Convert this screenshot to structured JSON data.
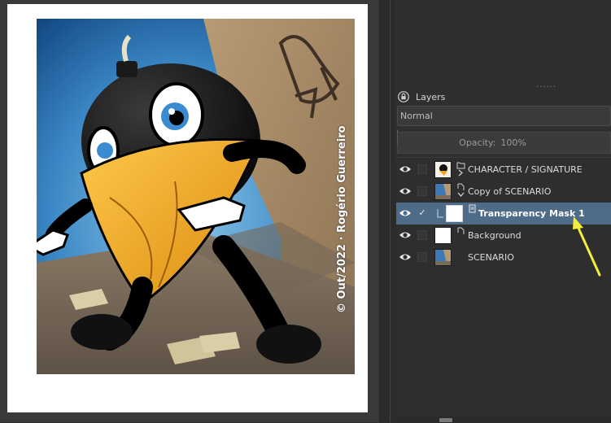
{
  "canvas": {
    "watermark": "© Out/2022 · Rogério Guerreiro",
    "paper_color": "#ffffff",
    "background_color": "#3a3a3a"
  },
  "panel": {
    "title": "Layers",
    "grip": "......",
    "blend_mode": "Normal",
    "opacity_label": "Opacity:",
    "opacity_value": "100%"
  },
  "layers": [
    {
      "name": "CHARACTER  /  SIGNATURE",
      "type": "group-layer",
      "visible": true,
      "selected": false,
      "expanded": false
    },
    {
      "name": "Copy of SCENARIO",
      "type": "clone-layer",
      "visible": true,
      "selected": false,
      "expanded": true
    },
    {
      "name": "Transparency Mask 1",
      "type": "transparency-mask",
      "visible": true,
      "selected": true,
      "checked": true
    },
    {
      "name": "Background",
      "type": "paint-layer",
      "visible": true,
      "selected": false
    },
    {
      "name": "SCENARIO",
      "type": "paint-layer",
      "visible": true,
      "selected": false
    }
  ],
  "annotation": {
    "arrow_color": "#f3ee3c"
  },
  "colors": {
    "selection": "#4e6b88",
    "panel": "#2f2f2f"
  }
}
